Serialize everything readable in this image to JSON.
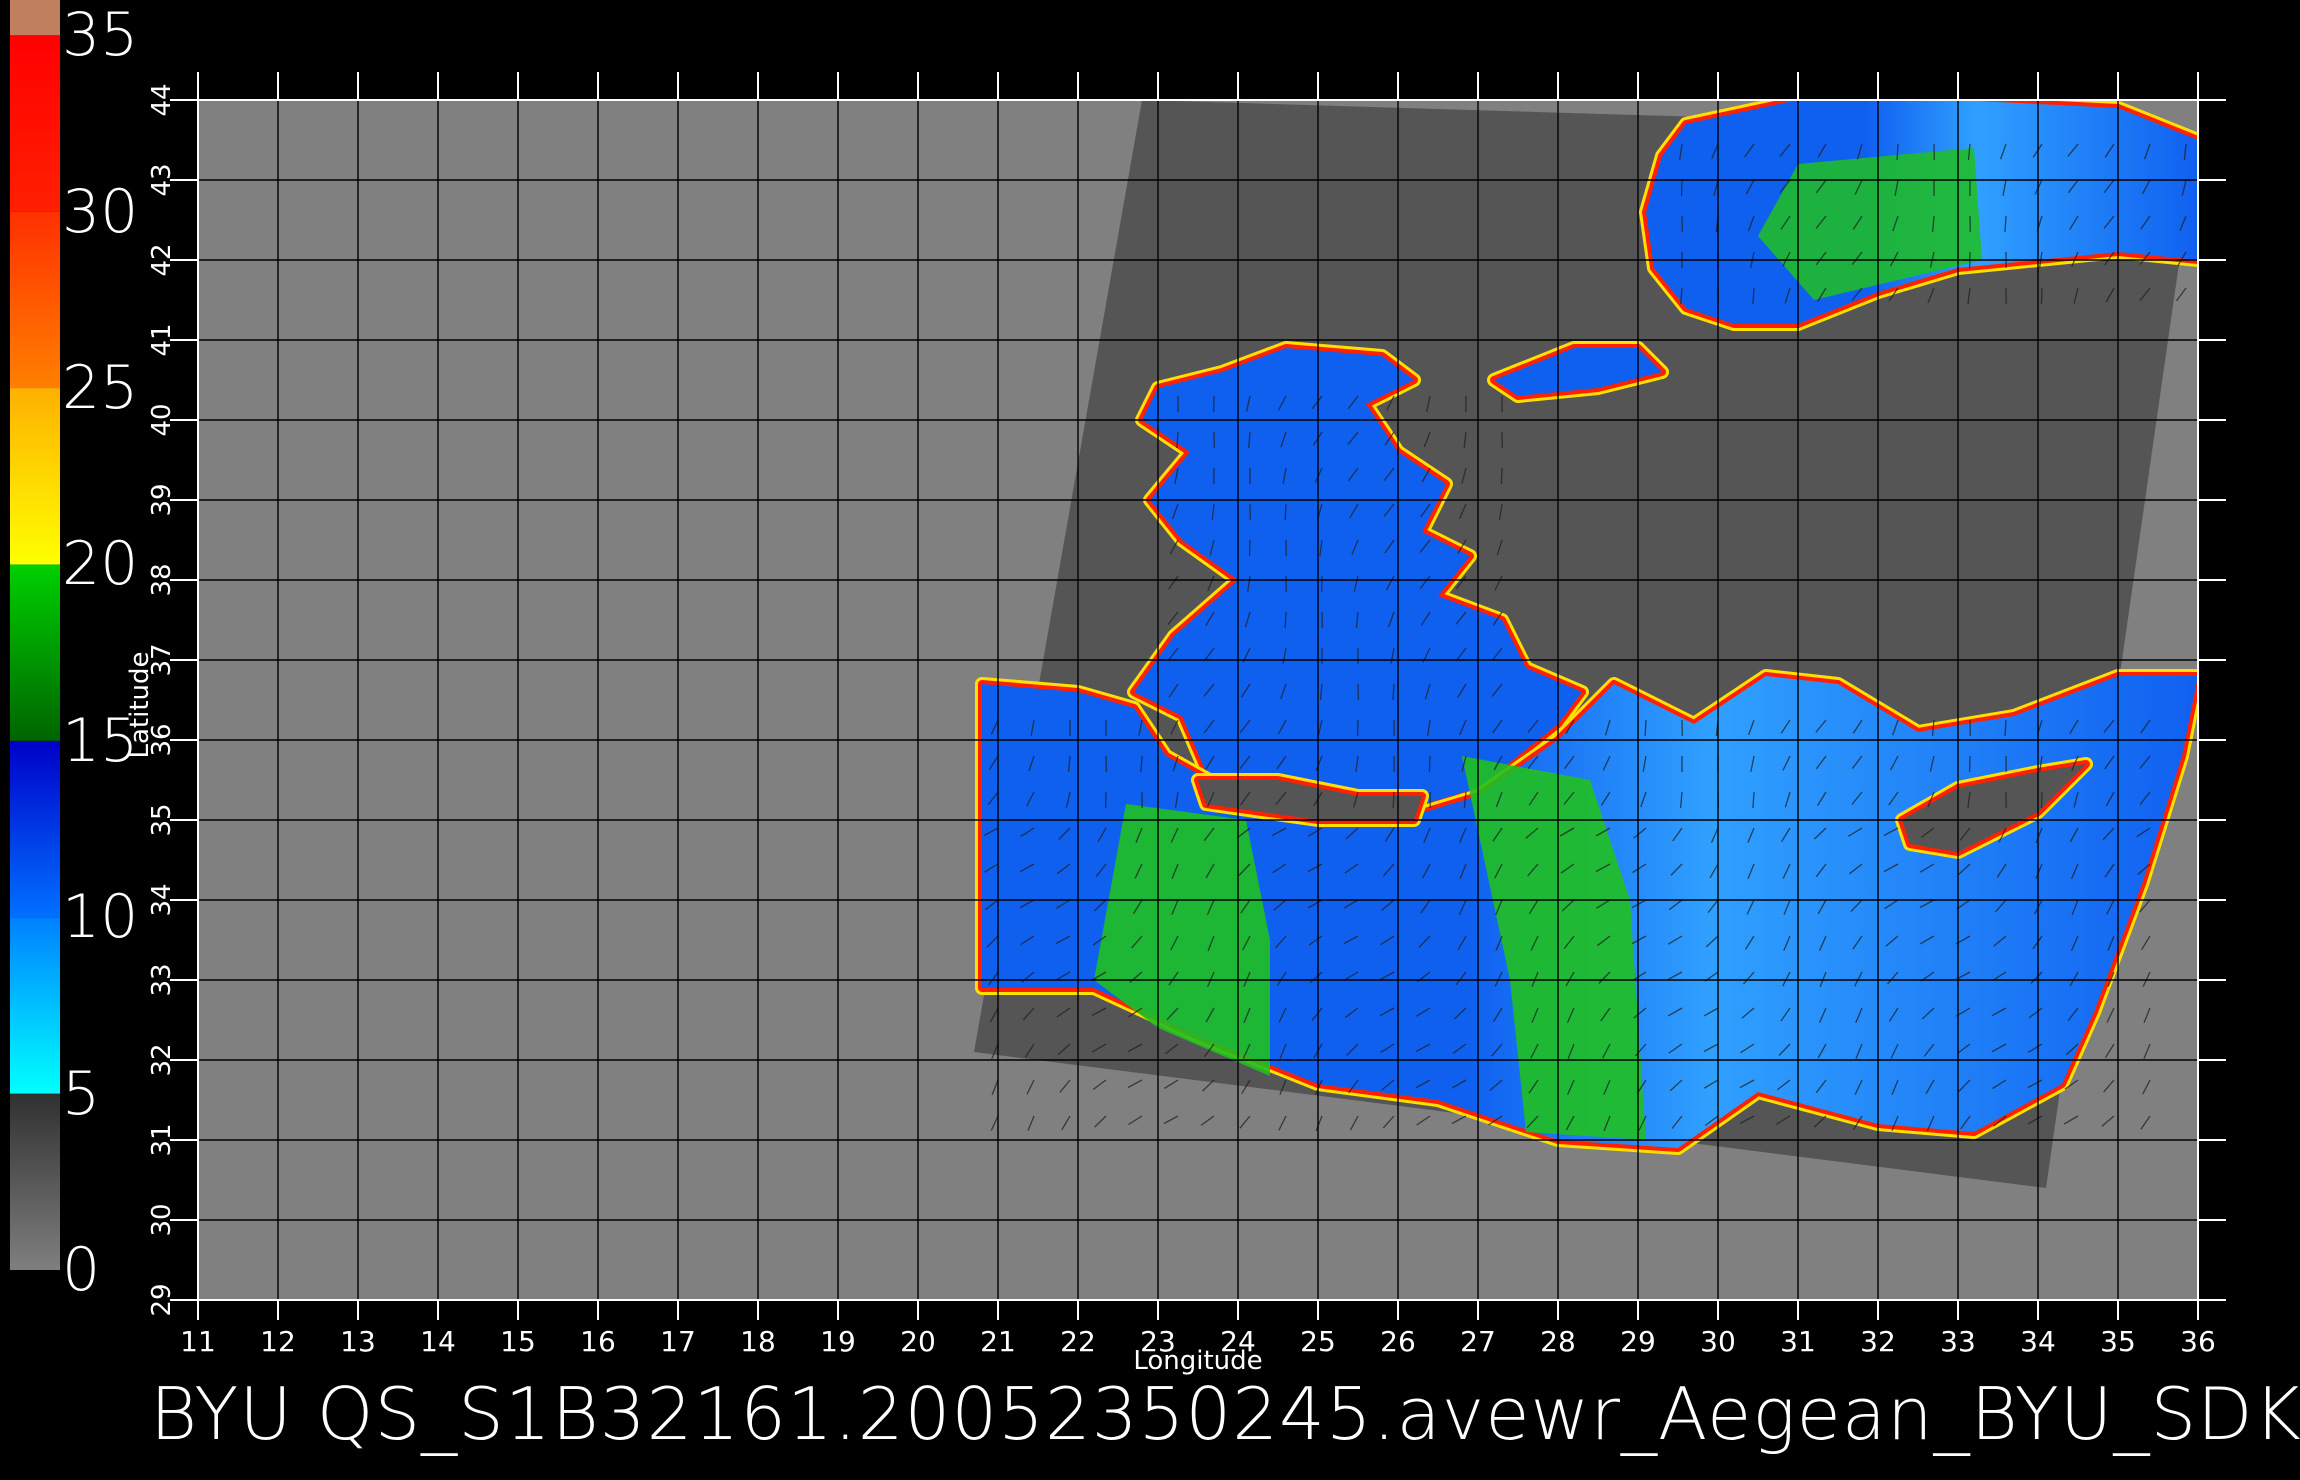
{
  "colorbar": {
    "labels": [
      "35",
      "30",
      "25",
      "20",
      "15",
      "10",
      "5",
      "0"
    ],
    "segments": [
      {
        "from": 0,
        "to": 5,
        "colors": [
          "#7f7f7f",
          "#303030"
        ]
      },
      {
        "from": 5,
        "to": 10,
        "colors": [
          "#00ffff",
          "#0080ff"
        ]
      },
      {
        "from": 10,
        "to": 15,
        "colors": [
          "#0070ff",
          "#0000c8"
        ]
      },
      {
        "from": 15,
        "to": 20,
        "colors": [
          "#006400",
          "#00d000"
        ]
      },
      {
        "from": 20,
        "to": 25,
        "colors": [
          "#ffff00",
          "#ffb000"
        ]
      },
      {
        "from": 25,
        "to": 30,
        "colors": [
          "#ff8000",
          "#ff3000"
        ]
      },
      {
        "from": 30,
        "to": 35,
        "colors": [
          "#ff2000",
          "#ff0000"
        ]
      },
      {
        "from": 35,
        "to": 36,
        "colors": [
          "#c08060",
          "#c08060"
        ]
      }
    ]
  },
  "map": {
    "lon_range": [
      11,
      36
    ],
    "lat_range": [
      29,
      44
    ],
    "lon_ticks": [
      "11",
      "12",
      "13",
      "14",
      "15",
      "16",
      "17",
      "18",
      "19",
      "20",
      "21",
      "22",
      "23",
      "24",
      "25",
      "26",
      "27",
      "28",
      "29",
      "30",
      "31",
      "32",
      "33",
      "34",
      "35",
      "36"
    ],
    "lat_ticks": [
      "29",
      "30",
      "31",
      "32",
      "33",
      "34",
      "35",
      "36",
      "37",
      "38",
      "39",
      "40",
      "41",
      "42",
      "43",
      "44"
    ],
    "xlabel": "Longitude",
    "ylabel": "Latitude",
    "colors": {
      "outside_swath": "#808080",
      "land": "#555555",
      "sea_low": "#1060f0",
      "sea_mid": "#30a0ff",
      "sea_green": "#20c020",
      "coast_red": "#ff2000",
      "coast_yellow": "#ffe000",
      "grid": "#000000",
      "wind_vector": "#202020"
    }
  },
  "footer": {
    "title": "BYU  QS_S1B32161.20052350245.avewr_Aegean_BYU_SDK"
  }
}
